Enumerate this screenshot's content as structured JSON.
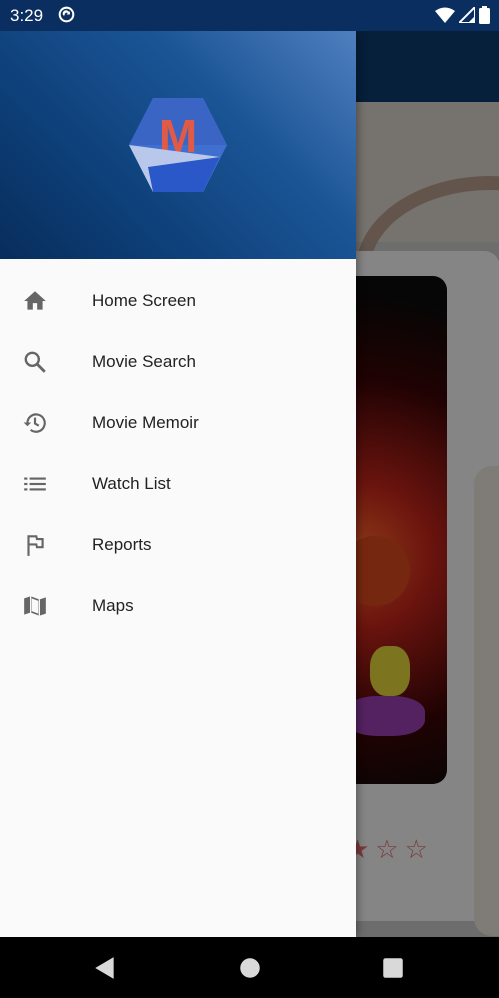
{
  "status_bar": {
    "time": "3:29",
    "icons": [
      "sync-icon",
      "wifi-icon",
      "signal-icon",
      "battery-icon"
    ]
  },
  "background_app": {
    "rating_stars": "★☆☆"
  },
  "drawer": {
    "logo_letter": "M",
    "items": [
      {
        "label": "Home Screen",
        "icon": "home-icon"
      },
      {
        "label": "Movie Search",
        "icon": "search-icon"
      },
      {
        "label": "Movie Memoir",
        "icon": "history-icon"
      },
      {
        "label": "Watch List",
        "icon": "list-icon"
      },
      {
        "label": "Reports",
        "icon": "flag-icon"
      },
      {
        "label": "Maps",
        "icon": "map-icon"
      }
    ]
  },
  "nav_bar": {
    "buttons": [
      "back-icon",
      "home-circle-icon",
      "recents-icon"
    ]
  },
  "colors": {
    "drawer_header": "#0d3f78",
    "accent": "#e04a3a",
    "icon": "#666666"
  }
}
